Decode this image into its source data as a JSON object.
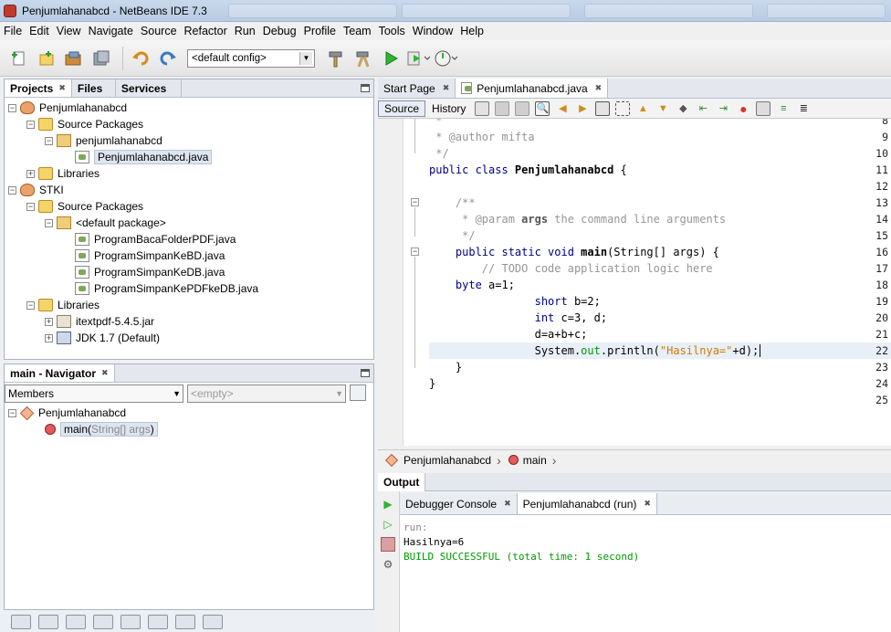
{
  "window": {
    "title": "Penjumlahanabcd - NetBeans IDE 7.3"
  },
  "menu": [
    "File",
    "Edit",
    "View",
    "Navigate",
    "Source",
    "Refactor",
    "Run",
    "Debug",
    "Profile",
    "Team",
    "Tools",
    "Window",
    "Help"
  ],
  "toolbar": {
    "config_value": "<default config>"
  },
  "projects_panel": {
    "tabs": [
      "Projects",
      "Files",
      "Services"
    ],
    "tree": [
      {
        "label": "Penjumlahanabcd",
        "icon": "project-icon",
        "expander": "−"
      },
      {
        "label": "Source Packages",
        "icon": "folder-icon",
        "expander": "−"
      },
      {
        "label": "penjumlahanabcd",
        "icon": "package-icon",
        "expander": "−"
      },
      {
        "label": "Penjumlahanabcd.java",
        "icon": "java-file-icon",
        "expander": ""
      },
      {
        "label": "Libraries",
        "icon": "folder-icon",
        "expander": "+"
      },
      {
        "label": "STKI",
        "icon": "project-icon",
        "expander": "−"
      },
      {
        "label": "Source Packages",
        "icon": "folder-icon",
        "expander": "−"
      },
      {
        "label": "<default package>",
        "icon": "package-icon",
        "expander": "−"
      },
      {
        "label": "ProgramBacaFolderPDF.java",
        "icon": "java-file-icon",
        "expander": ""
      },
      {
        "label": "ProgramSimpanKeBD.java",
        "icon": "java-file-icon",
        "expander": ""
      },
      {
        "label": "ProgramSimpanKeDB.java",
        "icon": "java-file-icon",
        "expander": ""
      },
      {
        "label": "ProgramSimpanKePDFkeDB.java",
        "icon": "java-file-icon",
        "expander": ""
      },
      {
        "label": "Libraries",
        "icon": "folder-icon",
        "expander": "−"
      },
      {
        "label": "itextpdf-5.4.5.jar",
        "icon": "jar-icon",
        "expander": "+"
      },
      {
        "label": "JDK 1.7 (Default)",
        "icon": "jdk-icon",
        "expander": "+"
      }
    ]
  },
  "navigator": {
    "title": "main - Navigator",
    "members_label": "Members",
    "filter_placeholder": "<empty>",
    "class_name": "Penjumlahanabcd",
    "method_name": "main(",
    "method_params": "String[] args",
    "method_close": ")"
  },
  "editor": {
    "tabs": [
      "Start Page",
      "Penjumlahanabcd.java"
    ],
    "view_tabs": [
      "Source",
      "History"
    ],
    "line_numbers": [
      "8",
      "9",
      "10",
      "11",
      "12",
      "13",
      "14",
      "15",
      "16",
      "17",
      "18",
      "19",
      "20",
      "21",
      "22",
      "23",
      "24",
      "25"
    ],
    "code": {
      "l8": " *",
      "l9": " * @author mifta",
      "l10": " */",
      "l11_kw": "public class ",
      "l11_name": "Penjumlahanabcd",
      "l11_rest": " {",
      "l13": "    /**",
      "l14_a": "     * @param ",
      "l14_b": "args",
      "l14_c": " the command line arguments",
      "l15": "     */",
      "l16_kw": "    public static void ",
      "l16_name": "main",
      "l16_rest": "(String[] args) {",
      "l17": "        // TODO code application logic here",
      "l18_kw": "    byte",
      "l18_rest": " a=1;",
      "l19_kw": "                short",
      "l19_rest": " b=2;",
      "l20_kw": "                int",
      "l20_rest": " c=3, d;",
      "l21": "                d=a+b+c;",
      "l22_a": "                System.",
      "l22_b": "out",
      "l22_c": ".println(",
      "l22_d": "\"Hasilnya=\"",
      "l22_e": "+d);",
      "l23": "    }",
      "l24": "}"
    },
    "breadcrumbs": [
      "Penjumlahanabcd",
      "main"
    ]
  },
  "output": {
    "title": "Output",
    "tabs": [
      "Debugger Console",
      "Penjumlahanabcd (run)"
    ],
    "lines": [
      "run:",
      "Hasilnya=6",
      "BUILD SUCCESSFUL (total time: 1 second)"
    ]
  },
  "colors": {
    "keyword": "#00008b",
    "comment": "#969696",
    "string": "#ce7b00",
    "build_success": "#009900"
  }
}
